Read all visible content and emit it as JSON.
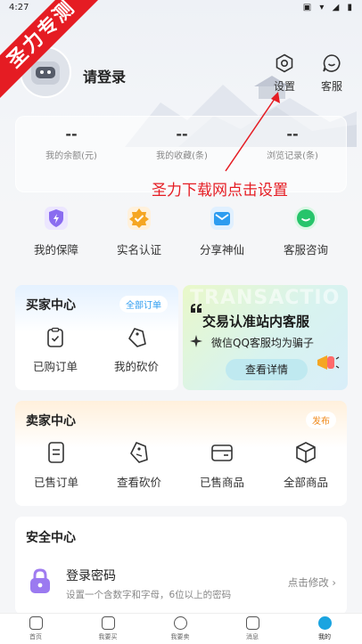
{
  "status_bar": {
    "time": "4:27",
    "icons": "▣ ▾ ◢ ▮"
  },
  "ribbon": "圣力专测",
  "profile": {
    "login_label": "请登录"
  },
  "top_actions": [
    {
      "label": "设置",
      "icon": "gear-icon"
    },
    {
      "label": "客服",
      "icon": "chat-smile-icon"
    }
  ],
  "stats": [
    {
      "value": "--",
      "label": "我的余额(元)"
    },
    {
      "value": "--",
      "label": "我的收藏(条)"
    },
    {
      "value": "--",
      "label": "浏览记录(条)"
    }
  ],
  "annotation": "圣力下载网点击设置",
  "quick_links": [
    {
      "label": "我的保障",
      "icon": "shield-lightning-icon",
      "color": "#8a6cf0"
    },
    {
      "label": "实名认证",
      "icon": "verified-badge-icon",
      "color": "#f5a623"
    },
    {
      "label": "分享神仙",
      "icon": "share-envelope-icon",
      "color": "#2d9cf0"
    },
    {
      "label": "客服咨询",
      "icon": "service-chat-icon",
      "color": "#27c46b"
    }
  ],
  "buyer_center": {
    "title": "买家中心",
    "all_orders": "全部订单",
    "items": [
      {
        "label": "已购订单",
        "icon": "clipboard-check-icon"
      },
      {
        "label": "我的砍价",
        "icon": "price-tag-icon"
      }
    ]
  },
  "promo": {
    "watermark": "TRANSACTIO",
    "title": "交易认准站内客服",
    "subtitle": "微信QQ客服均为骗子",
    "button": "查看详情"
  },
  "seller_center": {
    "title": "卖家中心",
    "publish": "发布",
    "items": [
      {
        "label": "已售订单",
        "icon": "clipboard-list-icon"
      },
      {
        "label": "查看砍价",
        "icon": "price-tag-icon"
      },
      {
        "label": "已售商品",
        "icon": "wallet-icon"
      },
      {
        "label": "全部商品",
        "icon": "box-icon"
      }
    ]
  },
  "security_center": {
    "title": "安全中心",
    "row_title": "登录密码",
    "row_subtitle": "设置一个含数字和字母，6位以上的密码",
    "row_action": "点击修改"
  },
  "tabbar": [
    {
      "label": "首页",
      "icon": "home-icon",
      "active": false
    },
    {
      "label": "我要买",
      "icon": "cart-icon",
      "active": false
    },
    {
      "label": "我要卖",
      "icon": "plus-circle-icon",
      "active": false
    },
    {
      "label": "消息",
      "icon": "message-icon",
      "active": false
    },
    {
      "label": "我的",
      "icon": "profile-icon",
      "active": true
    }
  ],
  "colors": {
    "accent": "#e51c23",
    "buyer_accent": "#2d9cf0",
    "seller_accent": "#f08a1c",
    "tab_active": "#1ba4e0"
  }
}
